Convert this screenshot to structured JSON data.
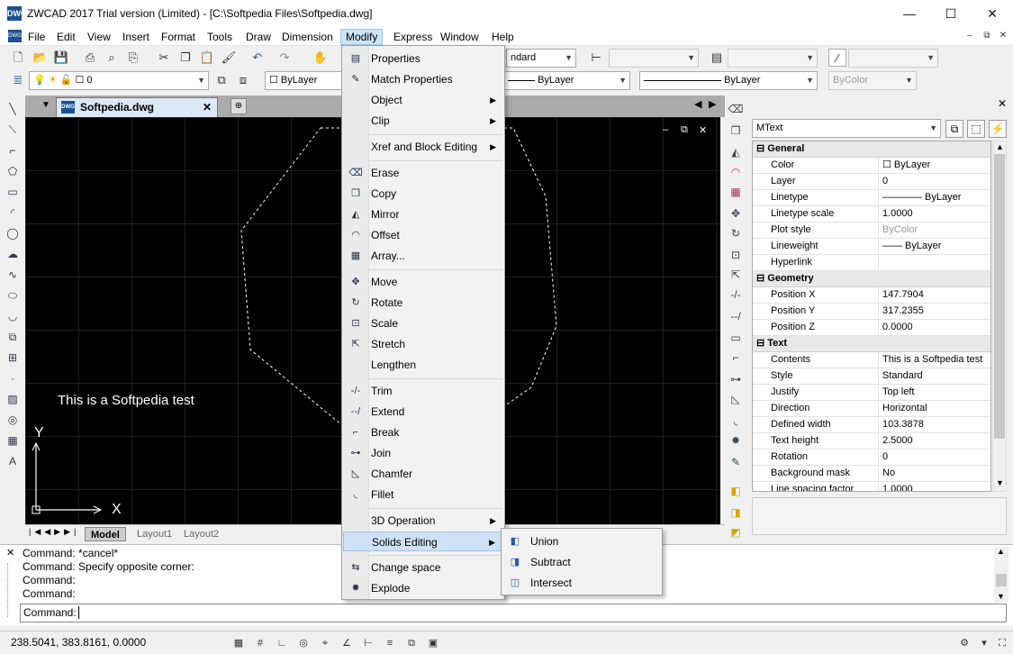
{
  "titlebar": {
    "title": "ZWCAD 2017 Trial version (Limited) - [C:\\Softpedia Files\\Softpedia.dwg]",
    "app_icon": "DWG",
    "minimize": "—",
    "maximize": "☐",
    "close": "✕"
  },
  "menubar": {
    "items": [
      "File",
      "Edit",
      "View",
      "Insert",
      "Format",
      "Tools",
      "Draw",
      "Dimension",
      "Modify",
      "Express",
      "Window",
      "Help"
    ],
    "active": "Modify",
    "mdi": [
      "–",
      "⧉",
      "✕"
    ]
  },
  "toolbar2": {
    "textstyle": "ndard",
    "layer_value": "0",
    "color": "ByLayer",
    "linetype": "ByLayer",
    "lineweight": "ByLayer",
    "plotstyle": "ByColor"
  },
  "doc": {
    "tab": "Softpedia.dwg",
    "text": "This is a Softpedia test",
    "canvas_btns": [
      "–",
      "⧉",
      "✕"
    ]
  },
  "ucs": {
    "x": "X",
    "y": "Y"
  },
  "layouts": {
    "tabs": [
      "Model",
      "Layout1",
      "Layout2"
    ]
  },
  "modify_menu": {
    "items": [
      {
        "label": "Properties",
        "icon": "properties-icon",
        "glyph": "▤"
      },
      {
        "label": "Match Properties",
        "icon": "match-properties-icon",
        "glyph": "✎"
      },
      {
        "label": "Object",
        "submenu": true
      },
      {
        "label": "Clip",
        "submenu": true
      },
      {
        "sep": true
      },
      {
        "label": "Xref and Block Editing",
        "submenu": true
      },
      {
        "sep": true
      },
      {
        "label": "Erase",
        "icon": "erase-icon",
        "glyph": "⌫"
      },
      {
        "label": "Copy",
        "icon": "copy-icon",
        "glyph": "❐"
      },
      {
        "label": "Mirror",
        "icon": "mirror-icon",
        "glyph": "◭"
      },
      {
        "label": "Offset",
        "icon": "offset-icon",
        "glyph": "◠"
      },
      {
        "label": "Array...",
        "icon": "array-icon",
        "glyph": "▦"
      },
      {
        "sep": true
      },
      {
        "label": "Move",
        "icon": "move-icon",
        "glyph": "✥"
      },
      {
        "label": "Rotate",
        "icon": "rotate-icon",
        "glyph": "↻"
      },
      {
        "label": "Scale",
        "icon": "scale-icon",
        "glyph": "⊡"
      },
      {
        "label": "Stretch",
        "icon": "stretch-icon",
        "glyph": "⇱"
      },
      {
        "label": "Lengthen",
        "icon": "",
        "glyph": ""
      },
      {
        "sep": true
      },
      {
        "label": "Trim",
        "icon": "trim-icon",
        "glyph": "-/-"
      },
      {
        "label": "Extend",
        "icon": "extend-icon",
        "glyph": "--/"
      },
      {
        "label": "Break",
        "icon": "break-icon",
        "glyph": "⌐"
      },
      {
        "label": "Join",
        "icon": "join-icon",
        "glyph": "⊶"
      },
      {
        "label": "Chamfer",
        "icon": "chamfer-icon",
        "glyph": "◺"
      },
      {
        "label": "Fillet",
        "icon": "fillet-icon",
        "glyph": "◟"
      },
      {
        "sep": true
      },
      {
        "label": "3D Operation",
        "submenu": true
      },
      {
        "label": "Solids Editing",
        "submenu": true,
        "highlight": true
      },
      {
        "sep": true
      },
      {
        "label": "Change space",
        "icon": "change-space-icon",
        "glyph": "⇆"
      },
      {
        "label": "Explode",
        "icon": "explode-icon",
        "glyph": "✸"
      }
    ]
  },
  "solids_submenu": {
    "items": [
      {
        "label": "Union",
        "glyph": "◧"
      },
      {
        "label": "Subtract",
        "glyph": "◨"
      },
      {
        "label": "Intersect",
        "glyph": "◫"
      }
    ]
  },
  "properties": {
    "object_type": "MText",
    "groups": [
      {
        "name": "General",
        "rows": [
          [
            "Color",
            "☐ ByLayer"
          ],
          [
            "Layer",
            "0"
          ],
          [
            "Linetype",
            "———— ByLayer"
          ],
          [
            "Linetype scale",
            "1.0000"
          ],
          [
            "Plot style",
            "ByColor"
          ],
          [
            "Lineweight",
            "—— ByLayer"
          ],
          [
            "Hyperlink",
            ""
          ]
        ]
      },
      {
        "name": "Geometry",
        "rows": [
          [
            "Position X",
            "147.7904"
          ],
          [
            "Position Y",
            "317.2355"
          ],
          [
            "Position Z",
            "0.0000"
          ]
        ]
      },
      {
        "name": "Text",
        "rows": [
          [
            "Contents",
            "This is a Softpedia test"
          ],
          [
            "Style",
            "Standard"
          ],
          [
            "Justify",
            "Top left"
          ],
          [
            "Direction",
            "Horizontal"
          ],
          [
            "Defined width",
            "103.3878"
          ],
          [
            "Text height",
            "2.5000"
          ],
          [
            "Rotation",
            "0"
          ],
          [
            "Background mask",
            "No"
          ],
          [
            "Line spacing factor",
            "1.0000"
          ]
        ]
      }
    ]
  },
  "command": {
    "lines": [
      "Command: *cancel*",
      "Command: Specify opposite corner:",
      "Command:",
      "Command:"
    ],
    "prompt": "Command:"
  },
  "status": {
    "coords": "238.5041, 383.8161, 0.0000"
  },
  "colors": {
    "accent": "#cce4f7",
    "canvas": "#000000"
  }
}
